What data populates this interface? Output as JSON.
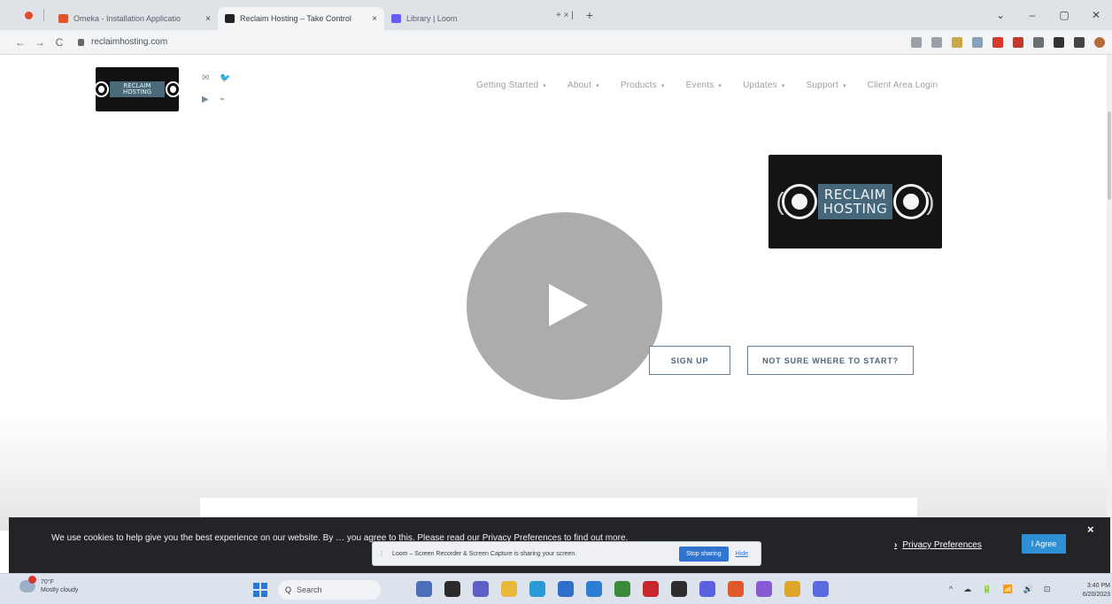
{
  "browser": {
    "tabs": [
      {
        "label": "Omeka - Installation Applicatio",
        "close": "×",
        "favicon_color": "#e0552d",
        "active": false
      },
      {
        "label": "Reclaim Hosting – Take Control",
        "close": "×",
        "favicon_color": "#222222",
        "active": true
      },
      {
        "label": "Library | Loom",
        "close": "",
        "favicon_color": "#625df5",
        "active": false
      }
    ],
    "tab_extra": "+ × |",
    "new_tab": "+",
    "window_controls": [
      "⌄",
      "–",
      "▢",
      "✕"
    ],
    "nav": {
      "back": "←",
      "forward": "→",
      "reload": "C"
    },
    "url": "reclaimhosting.com",
    "extension_icons": [
      {
        "name": "share-icon",
        "color": "#9aa0a8"
      },
      {
        "name": "star-icon",
        "color": "#9aa0a8"
      },
      {
        "name": "extension-a-icon",
        "color": "#c9a84a"
      },
      {
        "name": "extension-b-icon",
        "color": "#8aa0b8"
      },
      {
        "name": "extension-c-icon",
        "color": "#d93a2e"
      },
      {
        "name": "extension-d-icon",
        "color": "#c23a2e"
      },
      {
        "name": "extension-e-icon",
        "color": "#6b6f75"
      },
      {
        "name": "puzzle-icon",
        "color": "#333333"
      },
      {
        "name": "sidebar-icon",
        "color": "#444444"
      },
      {
        "name": "profile-icon",
        "color": "#b86a3a"
      }
    ]
  },
  "site": {
    "logo_text": "RECLAIM HOSTING",
    "social": [
      "✉",
      "🐦",
      "▶",
      "⌁"
    ],
    "nav": [
      {
        "label": "Getting Started",
        "caret": "▾"
      },
      {
        "label": "About",
        "caret": "▾"
      },
      {
        "label": "Products",
        "caret": "▾"
      },
      {
        "label": "Events",
        "caret": "▾"
      },
      {
        "label": "Updates",
        "caret": "▾"
      },
      {
        "label": "Support",
        "caret": "▾"
      },
      {
        "label": "Client Area Login",
        "caret": ""
      }
    ],
    "hero_logo_line1": "RECLAIM",
    "hero_logo_line2": "HOSTING",
    "buttons": {
      "sign_up": "SIGN UP",
      "not_sure": "NOT SURE WHERE TO START?"
    }
  },
  "cookie": {
    "text": "We use cookies to help give you the best experience on our website. By … you agree to this. Please read our Privacy Preferences to find out more.",
    "privacy_chevron": "›",
    "privacy_link": "Privacy Preferences",
    "agree": "I Agree",
    "close": "×"
  },
  "loom": {
    "message": "Loom – Screen Recorder & Screen Capture is sharing your screen.",
    "stop": "Stop sharing",
    "hide": "Hide",
    "grip": "⁞"
  },
  "taskbar": {
    "weather_temp": "70°F",
    "weather_desc": "Mostly cloudy",
    "search": "Search",
    "search_glyph": "Q",
    "apps": [
      {
        "name": "app-1-icon",
        "color": "#4a6fb8"
      },
      {
        "name": "app-2-icon",
        "color": "#2b2b2b"
      },
      {
        "name": "app-3-icon",
        "color": "#5b5fc7"
      },
      {
        "name": "app-4-icon",
        "color": "#e8b93a"
      },
      {
        "name": "app-5-icon",
        "color": "#2a9ad6"
      },
      {
        "name": "app-6-icon",
        "color": "#2f6fc9"
      },
      {
        "name": "app-7-icon",
        "color": "#2d7dd2"
      },
      {
        "name": "app-8-icon",
        "color": "#3a8a3a"
      },
      {
        "name": "app-9-icon",
        "color": "#c8262d"
      },
      {
        "name": "app-10-icon",
        "color": "#2c2c2c"
      },
      {
        "name": "app-11-icon",
        "color": "#5a5fe0"
      },
      {
        "name": "app-12-icon",
        "color": "#e0582a"
      },
      {
        "name": "app-13-icon",
        "color": "#8a5ad6"
      },
      {
        "name": "app-14-icon",
        "color": "#e0a52a"
      },
      {
        "name": "app-15-icon",
        "color": "#5a6ae0"
      }
    ],
    "tray": [
      "^",
      "☁",
      "🔋",
      "📶",
      "🔊",
      "⊡"
    ],
    "time": "3:40 PM",
    "date": "6/20/2023"
  }
}
